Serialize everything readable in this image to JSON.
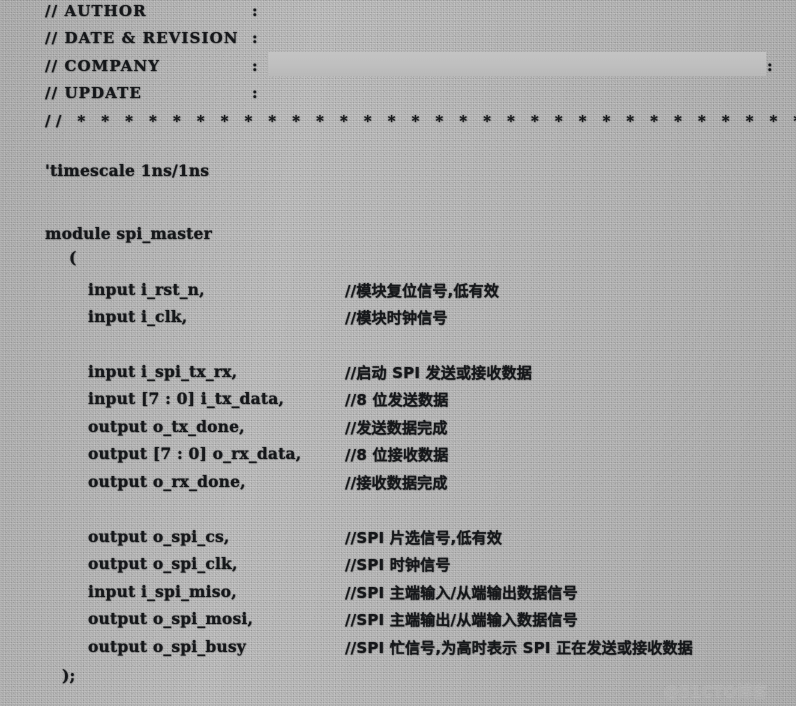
{
  "document": {
    "kind": "scanned-code-listing",
    "language": "Verilog",
    "background_color": "#c9c9c9",
    "ink_color": "#15171a"
  },
  "header_comment": {
    "fields": [
      {
        "label": "// AUTHOR",
        "separator": ":",
        "value": ""
      },
      {
        "label": "// DATE & REVISION",
        "separator": ":",
        "value": ""
      },
      {
        "label": "// COMPANY",
        "separator": ":",
        "value": "",
        "redacted": true,
        "trailing_separator": ":"
      },
      {
        "label": "// UPDATE",
        "separator": ":",
        "value": ""
      }
    ],
    "divider": "// * * * * * * * * * * * * * * * * * * * * * * * * * * * * * * * * * * * *"
  },
  "directive": "'timescale 1ns/1ns",
  "module": {
    "keyword_line": "module spi_master",
    "open_paren": "(",
    "close_paren": ");",
    "ports": [
      {
        "decl": "input i_rst_n,",
        "comment": "//模块复位信号,低有效"
      },
      {
        "decl": "input i_clk,",
        "comment": "//模块时钟信号"
      },
      {
        "decl": "",
        "comment": ""
      },
      {
        "decl": "input i_spi_tx_rx,",
        "comment": "//启动 SPI 发送或接收数据"
      },
      {
        "decl": "input [7 : 0] i_tx_data,",
        "comment": "//8 位发送数据"
      },
      {
        "decl": "output o_tx_done,",
        "comment": "//发送数据完成"
      },
      {
        "decl": "output [7 : 0] o_rx_data,",
        "comment": "//8 位接收数据"
      },
      {
        "decl": "output o_rx_done,",
        "comment": "//接收数据完成"
      },
      {
        "decl": "",
        "comment": ""
      },
      {
        "decl": "output o_spi_cs,",
        "comment": "//SPI 片选信号,低有效"
      },
      {
        "decl": "output o_spi_clk,",
        "comment": "//SPI 时钟信号"
      },
      {
        "decl": "input i_spi_miso,",
        "comment": "//SPI 主端输入/从端输出数据信号"
      },
      {
        "decl": "output o_spi_mosi,",
        "comment": "//SPI 主端输出/从端输入数据信号"
      },
      {
        "decl": "output o_spi_busy",
        "comment": "//SPI 忙信号,为高时表示 SPI 正在发送或接收数据"
      }
    ]
  },
  "watermark": "@51CTO博客"
}
